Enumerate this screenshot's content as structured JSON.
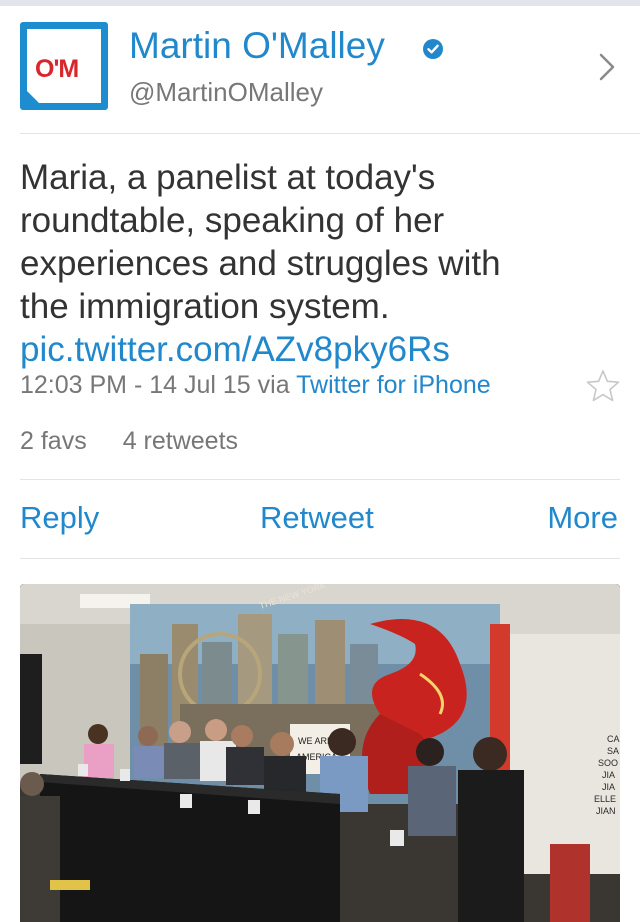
{
  "user": {
    "name": "Martin O'Malley",
    "handle": "@MartinOMalley",
    "avatar_text": "O'M",
    "verified": true
  },
  "tweet": {
    "text_lines": [
      "Maria, a panelist at today's",
      "roundtable, speaking of her",
      "experiences and struggles with",
      "the immigration system."
    ],
    "link": "pic.twitter.com/AZv8pky6Rs",
    "time": "12:03 PM - 14 Jul 15",
    "via": "via",
    "source": "Twitter for iPhone",
    "favs": "2 favs",
    "retweets": "4 retweets"
  },
  "actions": {
    "reply": "Reply",
    "retweet": "Retweet",
    "more": "More"
  },
  "photo": {
    "banner_top": "THE NEW YORK",
    "sign_text_1": "WE ARE",
    "sign_text_2": "AMERICA",
    "wall_words": [
      "CA",
      "SA",
      "SOO",
      "JIA",
      "JIA",
      "ELLE",
      "JIAN"
    ]
  },
  "icons": {
    "verified": "verified-badge-icon",
    "chevron": "chevron-right-icon",
    "star": "star-icon"
  },
  "colors": {
    "link_blue": "#2288cc",
    "avatar_blue": "#1d8dcf",
    "avatar_red": "#d9262c",
    "text": "#333333",
    "meta_gray": "#777777"
  }
}
